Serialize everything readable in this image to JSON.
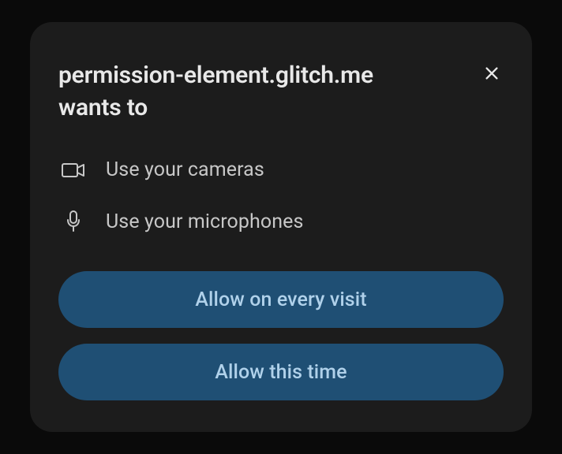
{
  "dialog": {
    "origin": "permission-element.glitch.me",
    "title_suffix": "wants to",
    "permissions": [
      {
        "icon": "camera-icon",
        "label": "Use your cameras"
      },
      {
        "icon": "microphone-icon",
        "label": "Use your microphones"
      }
    ],
    "buttons": {
      "allow_always": "Allow on every visit",
      "allow_once": "Allow this time"
    }
  }
}
